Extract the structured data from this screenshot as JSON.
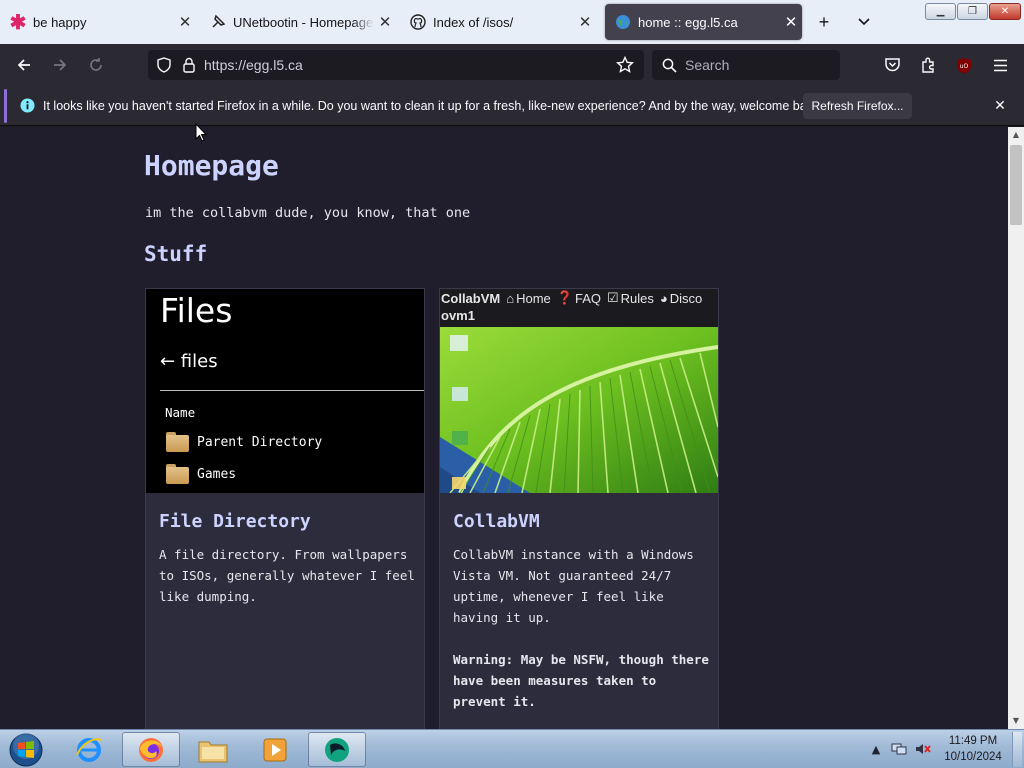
{
  "tabs": [
    {
      "title": "be happy",
      "icon": "asterisk-icon",
      "active": false
    },
    {
      "title": "UNetbootin - Homepage and...",
      "icon": "pin-icon",
      "active": false
    },
    {
      "title": "Index of /isos/",
      "icon": "github-icon",
      "active": false
    },
    {
      "title": "home :: egg.l5.ca",
      "icon": "globe-icon",
      "active": true
    }
  ],
  "navbar": {
    "url": "https://egg.l5.ca",
    "search_placeholder": "Search"
  },
  "notification": {
    "message": "It looks like you haven't started Firefox in a while. Do you want to clean it up for a fresh, like-new experience? And by the way, welcome back!",
    "button": "Refresh Firefox..."
  },
  "page": {
    "title": "Homepage",
    "intro": "im the collabvm dude, you know, that one",
    "section": "Stuff",
    "cards": [
      {
        "title": "File Directory",
        "description": "A file directory. From wallpapers to ISOs, generally whatever I feel like dumping.",
        "thumbnail": {
          "heading": "Files",
          "crumb": "← files",
          "column": "Name",
          "rows": [
            "Parent Directory",
            "Games"
          ]
        }
      },
      {
        "title": "CollabVM",
        "description": "CollabVM instance with a Windows Vista VM. Not guaranteed 24/7 uptime, whenever I feel like having it up.",
        "warning": "Warning: May be NSFW, though there have been measures taken to prevent it.",
        "thumbnail": {
          "brand": "CollabVM",
          "nav": [
            "Home",
            "FAQ",
            "Rules",
            "Disco"
          ],
          "subtitle": "ovm1"
        }
      }
    ]
  },
  "taskbar": {
    "time": "11:49 PM",
    "date": "10/10/2024"
  },
  "colors": {
    "page_bg": "#201e2c",
    "card_bg": "#2c2c3c",
    "heading": "#cdd3ff",
    "toolbar": "#2b2a33"
  }
}
